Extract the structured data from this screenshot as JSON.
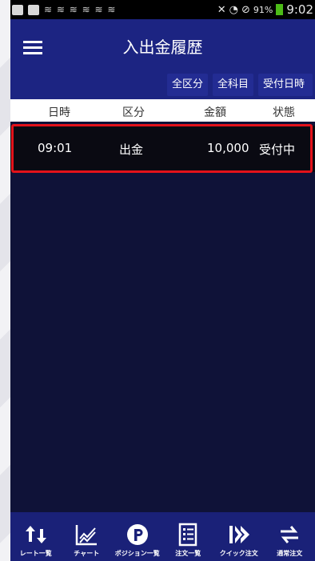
{
  "status_bar": {
    "waves": "≋ ≋ ≋ ≋ ≋ ≋",
    "battery_percent": "91%",
    "time": "9:02"
  },
  "header": {
    "title": "入出金履歴",
    "filters": [
      {
        "label": "全区分"
      },
      {
        "label": "全科目"
      },
      {
        "label": "受付日時"
      }
    ]
  },
  "table": {
    "columns": [
      "日時",
      "区分",
      "金額",
      "状態"
    ],
    "rows": [
      {
        "time": "09:01",
        "kubun": "出金",
        "amount": "10,000",
        "status": "受付中"
      }
    ]
  },
  "bottom_nav": [
    {
      "label": "レート一覧",
      "icon": "rate-arrows-icon"
    },
    {
      "label": "チャート",
      "icon": "chart-icon"
    },
    {
      "label": "ポジション一覧",
      "icon": "position-p-icon"
    },
    {
      "label": "注文一覧",
      "icon": "order-list-icon"
    },
    {
      "label": "クイック注文",
      "icon": "quick-order-icon"
    },
    {
      "label": "通常注文",
      "icon": "normal-order-icon"
    }
  ],
  "colors": {
    "header_bg": "#1c2482",
    "body_bg": "#0f1238",
    "highlight": "#e3121a",
    "nav_bg": "#1a2178"
  }
}
